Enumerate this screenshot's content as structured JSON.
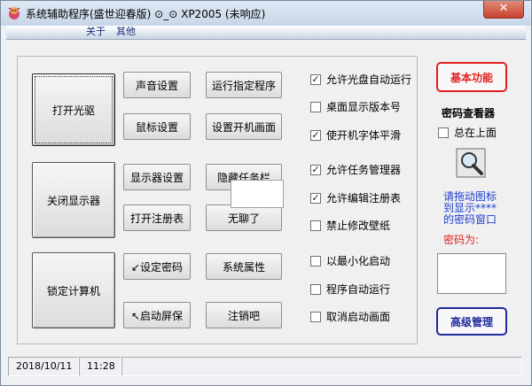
{
  "window": {
    "title": "系统辅助程序(盛世迎春版) ⊙_⊙ XP2005 (未响应)",
    "close_label": "✕"
  },
  "menu": [
    "关于",
    "其他"
  ],
  "left_buttons": [
    "打开光驱",
    "关闭显示器",
    "锁定计算机"
  ],
  "mid_buttons": [
    "声音设置",
    "鼠标设置",
    "显示器设置",
    "打开注册表",
    "↙设定密码",
    "↖启动屏保"
  ],
  "right_buttons": [
    "运行指定程序",
    "设置开机画面",
    "隐藏任务栏",
    "无聊了",
    "系统属性",
    "注销吧"
  ],
  "checkboxes": [
    {
      "label": "允许光盘自动运行",
      "checked": true
    },
    {
      "label": "桌面显示版本号",
      "checked": false
    },
    {
      "label": "使开机字体平滑",
      "checked": true
    },
    {
      "label": "允许任务管理器",
      "checked": true
    },
    {
      "label": "允许编辑注册表",
      "checked": true
    },
    {
      "label": "禁止修改壁纸",
      "checked": false
    },
    {
      "label": "以最小化启动",
      "checked": false
    },
    {
      "label": "程序自动运行",
      "checked": false
    },
    {
      "label": "取消启动画面",
      "checked": false
    }
  ],
  "side_panel": {
    "basic_button": "基本功能",
    "viewer_title": "密码查看器",
    "on_top_label": "总在上面",
    "on_top_checked": false,
    "drag_hint_1": "请拖动图标",
    "drag_hint_2": "到显示****",
    "drag_hint_3": "的密码窗口",
    "password_label": "密码为:",
    "password_value": "",
    "advanced_button": "高级管理"
  },
  "status": {
    "date": "2018/10/11",
    "time": "11:28"
  },
  "colors": {
    "red_accent": "#e02020",
    "blue_accent": "#1e2a9e",
    "hint_blue": "#1f3fd0"
  }
}
